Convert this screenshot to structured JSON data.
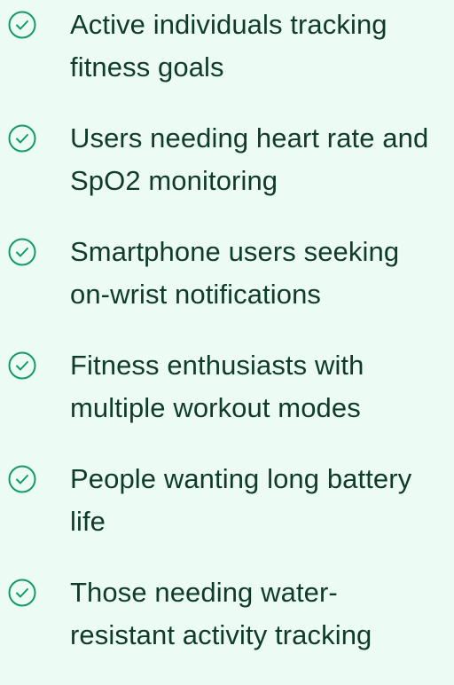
{
  "features": {
    "icon": "check-circle-icon",
    "icon_color": "#139a6a",
    "items": [
      {
        "label": "Active individuals tracking\nfitness goals"
      },
      {
        "label": "Users needing heart rate and\nSpO2 monitoring"
      },
      {
        "label": "Smartphone users seeking\non-wrist notifications"
      },
      {
        "label": "Fitness enthusiasts with\nmultiple workout modes"
      },
      {
        "label": "People wanting long battery\nlife"
      },
      {
        "label": "Those needing water-\nresistant activity tracking"
      }
    ]
  }
}
